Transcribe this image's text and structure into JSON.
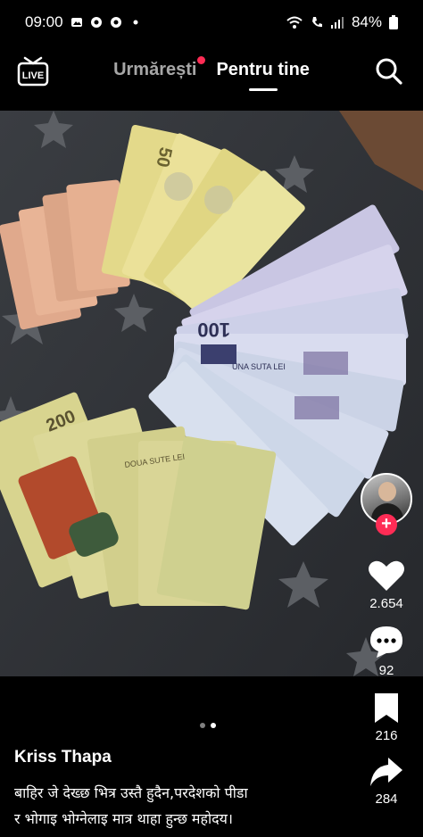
{
  "status_bar": {
    "time": "09:00",
    "battery": "84%"
  },
  "top_nav": {
    "tabs": [
      {
        "label": "Urmărești",
        "active": false,
        "has_dot": true
      },
      {
        "label": "Pentru tine",
        "active": true
      }
    ],
    "live_label": "LIVE"
  },
  "video": {
    "banknote_labels": [
      "UNA SUTA LEI",
      "100",
      "50",
      "200",
      "DOUA SUTE LEI"
    ]
  },
  "caption": {
    "author": "Kriss Thapa",
    "text_line1": "बाहिर जे देख्छ भित्र उस्तै हुदैन,परदेशको पीडा",
    "text_line2": "र भोगाइ भोग्नेलाइ मात्र थाहा हुन्छ महोदय।"
  },
  "actions": {
    "likes": "2.654",
    "comments": "92",
    "saves": "216",
    "shares": "284"
  },
  "colors": {
    "accent": "#fe2c55",
    "background": "#000000"
  }
}
